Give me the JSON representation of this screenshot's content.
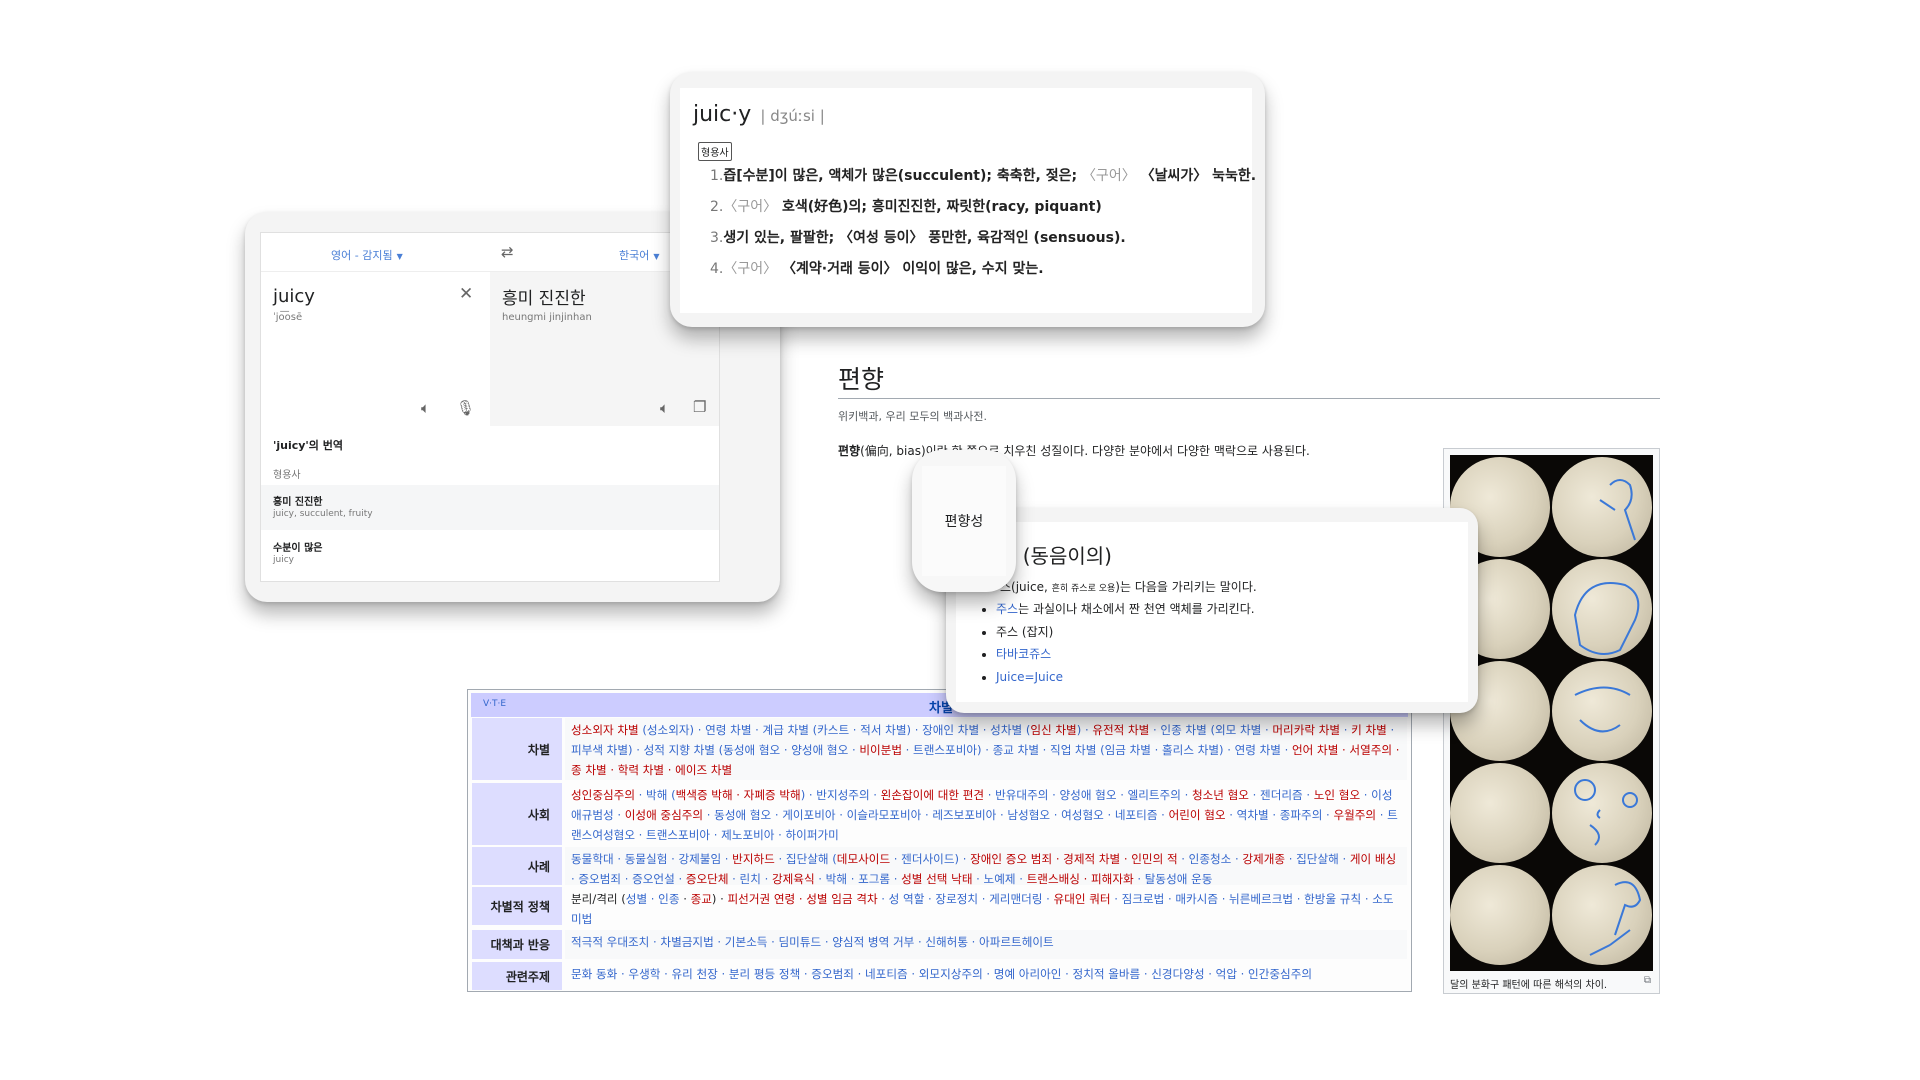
{
  "translate": {
    "source_lang": "영어 - 감지됨",
    "target_lang": "한국어",
    "source_text": "juicy",
    "source_phonetic": "ˈjo͞osē",
    "target_text": "흥미 진진한",
    "target_romanization": "heungmi jinjinhan",
    "translations_title": "'juicy'의 번역",
    "pos": "형용사",
    "results": [
      {
        "word": "흥미 진진한",
        "synonyms": "juicy, succulent, fruity"
      },
      {
        "word": "수분이 많은",
        "synonyms": "juicy"
      }
    ]
  },
  "dictionary": {
    "headword": "juic·y",
    "pronunciation": "| dʒúːsi |",
    "pos_badge": "형용사",
    "senses": [
      {
        "num": "1.",
        "segments": [
          [
            "즙[수분]이 많은, 액체가 많은(succulent); 축축한, 젖은; ",
            "k"
          ],
          [
            "〈구어〉",
            "g"
          ],
          [
            " 〈날씨가〉 눅눅한.",
            "k"
          ]
        ]
      },
      {
        "num": "2.",
        "segments": [
          [
            "〈구어〉",
            "g"
          ],
          [
            " 호색(好色)의; 흥미진진한, 짜릿한(racy, piquant)",
            "k"
          ]
        ]
      },
      {
        "num": "3.",
        "segments": [
          [
            "생기 있는, 팔팔한; 〈여성 등이〉 풍만한, 육감적인 (sensuous).",
            "k"
          ]
        ]
      },
      {
        "num": "4.",
        "segments": [
          [
            "〈구어〉",
            "g"
          ],
          [
            " 〈계약·거래 등이〉 이익이 많은, 수지 맞는.",
            "k"
          ]
        ]
      }
    ]
  },
  "wiki": {
    "title": "편향",
    "tagline": "위키백과, 우리 모두의 백과사전.",
    "intro_bold": "편향",
    "intro_rest": "(偏向, bias)이란 한 쪽으로 치우친 성질이다. 다양한 분야에서 다양한 맥락으로 사용된다.",
    "image_caption": "달의 분화구 패턴에 따른 해석의 차이."
  },
  "bubble": {
    "text": "편향성"
  },
  "disambig": {
    "title": "스 (동음이의)",
    "intro_a": "스(juice, ",
    "intro_small": "흔히 쥬스로 오용",
    "intro_b": ")는 다음을 가리키는 말이다.",
    "items": [
      {
        "link": "주스",
        "rest": "는 과실이나 채소에서 짠 천연 액체를 가리킨다."
      },
      {
        "link": "",
        "rest": "주스 (잡지)"
      },
      {
        "link": "타바코쥬스",
        "rest": ""
      },
      {
        "link": "Juice=Juice",
        "rest": ""
      }
    ]
  },
  "navbox": {
    "vte": "V·T·E",
    "title": "차별",
    "rows": [
      {
        "label": "차별",
        "segments": [
          [
            "성소외자 차별",
            "r"
          ],
          [
            " (성소외자) · 연령 차별 · 계급 차별 (카스트 · 적서 차별) · 장애인 차별 · 성차별 (",
            "b"
          ],
          [
            "임신 차별",
            "r"
          ],
          [
            ") · ",
            "b"
          ],
          [
            "유전적 차별",
            "r"
          ],
          [
            " · 인종 차별 (외모 차별 · ",
            "b"
          ],
          [
            "머리카락 차별",
            "r"
          ],
          [
            " · ",
            "b"
          ],
          [
            "키 차별",
            "r"
          ],
          [
            " · 피부색 차별) · 성적 지향 차별 (동성애 혐오 · 양성애 혐오 · ",
            "b"
          ],
          [
            "비이분법",
            "r"
          ],
          [
            " · 트랜스포비아) · 종교 차별 · 직업 차별 (임금 차별 · 홀리스 차별) · 연령 차별 · ",
            "b"
          ],
          [
            "언어 차별 · 서열주의 · 종 차별 · 학력 차별 · 에이즈 차별",
            "r"
          ]
        ]
      },
      {
        "label": "사회",
        "segments": [
          [
            "성인중심주의",
            "r"
          ],
          [
            " · 박해 (",
            "b"
          ],
          [
            "백색증 박해 · 자폐증 박해",
            "r"
          ],
          [
            ") · 반지성주의 · ",
            "b"
          ],
          [
            "왼손잡이에 대한 편견",
            "r"
          ],
          [
            " · 반유대주의 · 양성애 혐오 · 엘리트주의 · ",
            "b"
          ],
          [
            "청소년 혐오",
            "r"
          ],
          [
            " · 젠더리즘 · ",
            "b"
          ],
          [
            "노인 혐오",
            "r"
          ],
          [
            " · 이성애규범성 · ",
            "b"
          ],
          [
            "이성애 중심주의",
            "r"
          ],
          [
            " · 동성애 혐오 · 게이포비아 · 이슬라모포비아 · 레즈보포비아 · 남성혐오 · 여성혐오 · 네포티즘 · ",
            "b"
          ],
          [
            "어린이 혐오",
            "r"
          ],
          [
            " · 역차별 · 종파주의 · ",
            "b"
          ],
          [
            "우월주의",
            "r"
          ],
          [
            " · 트랜스여성혐오 · 트랜스포비아 · 제노포비아 · 하이퍼가미",
            "b"
          ]
        ]
      },
      {
        "label": "사례",
        "segments": [
          [
            "동물학대 · 동물실험 · 강제불임 · ",
            "b"
          ],
          [
            "반지하드",
            "r"
          ],
          [
            " · 집단살해 (",
            "b"
          ],
          [
            "데모사이드",
            "r"
          ],
          [
            " · 젠더사이드) · ",
            "b"
          ],
          [
            "장애인 증오 범죄 · 경제적 차별 · 인민의 적",
            "r"
          ],
          [
            " · 인종청소 · ",
            "b"
          ],
          [
            "강제개종",
            "r"
          ],
          [
            " · 집단살해 · ",
            "b"
          ],
          [
            "게이 배싱",
            "r"
          ],
          [
            " · 증오범죄 · 증오언설 · ",
            "b"
          ],
          [
            "증오단체",
            "r"
          ],
          [
            " · 린치 · ",
            "b"
          ],
          [
            "강제육식",
            "r"
          ],
          [
            " · 박해 · 포그롬 · ",
            "b"
          ],
          [
            "성별 선택 낙태",
            "r"
          ],
          [
            " · 노예제 · ",
            "b"
          ],
          [
            "트랜스배싱 · 피해자화",
            "r"
          ],
          [
            " · 탈동성애 운동",
            "b"
          ]
        ]
      },
      {
        "label": "차별적 정책",
        "segments": [
          [
            "분리/격리 (",
            "k"
          ],
          [
            "성별 · 인종",
            "b"
          ],
          [
            " · ",
            "k"
          ],
          [
            "종교",
            "r"
          ],
          [
            ") · ",
            "k"
          ],
          [
            "피선거권 연령 · 성별 임금 격차",
            "r"
          ],
          [
            " · 성 역할 · 장로정치 · 게리맨더링 · ",
            "b"
          ],
          [
            "유대인 쿼터",
            "r"
          ],
          [
            " · 짐크로법 · 매카시즘 · 뉘른베르크법 · 한방울 규칙 · 소도미법",
            "b"
          ]
        ]
      },
      {
        "label": "대책과 반응",
        "segments": [
          [
            "적극적 우대조치 · 차별금지법 · 기본소득 · 딤미튜드 · 양심적 병역 거부 · 신해허통 · 아파르트헤이트",
            "b"
          ]
        ]
      },
      {
        "label": "관련주제",
        "segments": [
          [
            "문화 동화 · 우생학 · 유리 천장 · 분리 평등 정책 · 증오범죄 · 네포티즘 · 외모지상주의 · 명예 아리아인 · 정치적 올바름 · 신경다양성 · 억압 · 인간중심주의",
            "b"
          ]
        ]
      }
    ]
  },
  "colors": {
    "link": "#3366cc",
    "redlink": "#ba0000",
    "nav_header": "#ccccff",
    "nav_label": "#ddddff"
  }
}
